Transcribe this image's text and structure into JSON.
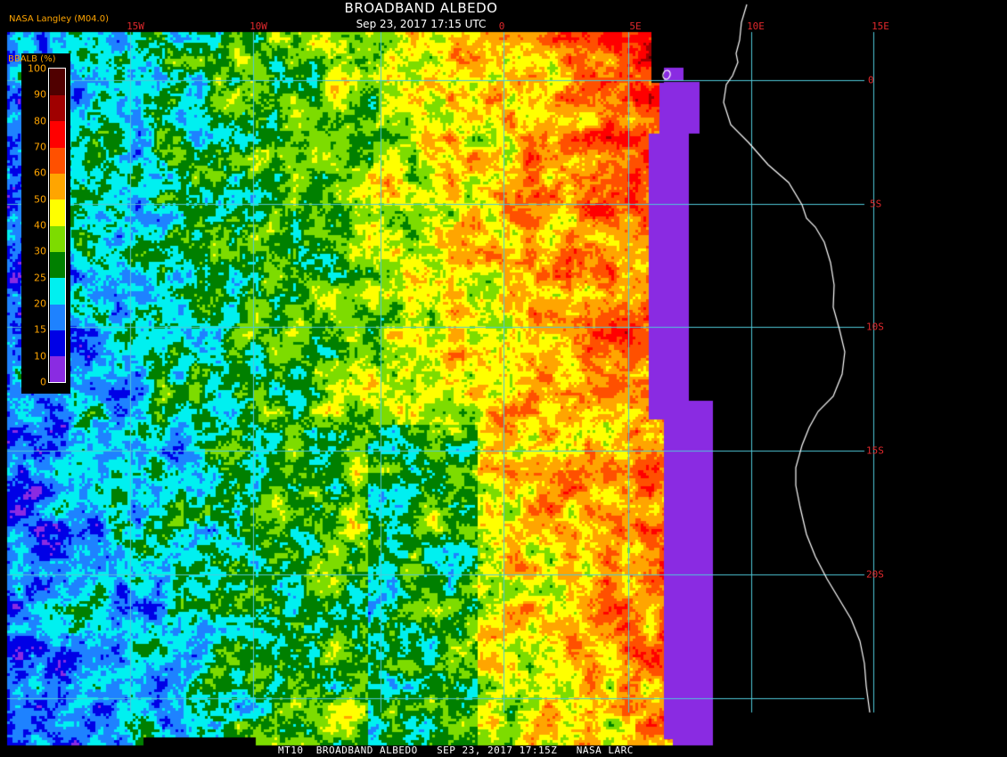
{
  "header": {
    "title": "BROADBAND ALBEDO",
    "subtitle": "Sep 23, 2017 17:15 UTC",
    "org_label": "NASA Langley (M04.0)"
  },
  "footer": {
    "text": "MT10  BROADBAND ALBEDO   SEP 23, 2017 17:15Z   NASA LARC"
  },
  "legend": {
    "title": "BBALB (%)",
    "tick_labels": [
      "100",
      "90",
      "80",
      "70",
      "60",
      "50",
      "40",
      "30",
      "25",
      "20",
      "15",
      "10",
      "0"
    ],
    "bins": [
      {
        "range": "0-10",
        "color": "#8a2be2"
      },
      {
        "range": "10-15",
        "color": "#0000e6"
      },
      {
        "range": "15-20",
        "color": "#1e82ff"
      },
      {
        "range": "20-25",
        "color": "#00f0f0"
      },
      {
        "range": "25-30",
        "color": "#008000"
      },
      {
        "range": "30-40",
        "color": "#7ddc00"
      },
      {
        "range": "40-50",
        "color": "#ffff00"
      },
      {
        "range": "50-60",
        "color": "#ffa500"
      },
      {
        "range": "60-70",
        "color": "#ff5000"
      },
      {
        "range": "70-80",
        "color": "#ff0000"
      },
      {
        "range": "80-90",
        "color": "#a00000"
      },
      {
        "range": "90-100",
        "color": "#500000"
      }
    ]
  },
  "axes": {
    "lon_labels": [
      "15W",
      "10W",
      "0",
      "5E",
      "10E",
      "15E"
    ],
    "lat_labels": [
      "0",
      "5S",
      "10S",
      "15S",
      "20S"
    ]
  },
  "colors": {
    "grid": "#4fc8d8",
    "coastline": "#ffffff",
    "axis_labels": "#e0282c",
    "no_data": "#000000"
  }
}
